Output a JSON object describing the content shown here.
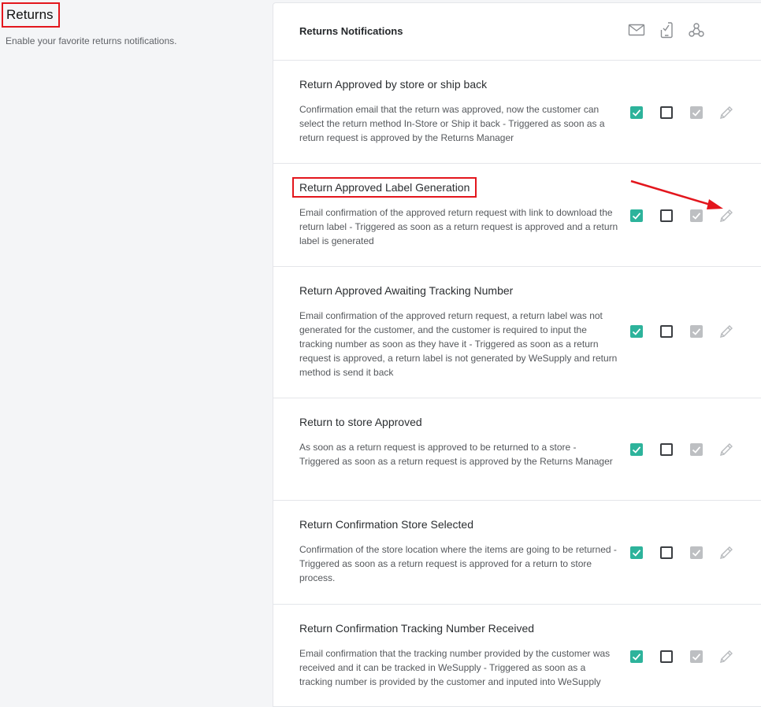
{
  "section": {
    "title": "Returns",
    "description": "Enable your favorite returns notifications."
  },
  "card": {
    "title": "Returns Notifications",
    "channel_icons": [
      "email-icon",
      "sms-icon",
      "webhook-icon"
    ]
  },
  "colors": {
    "accent_checked": "#2db39b",
    "disabled_checked": "#bdbfc2",
    "annotation_red": "#e3161d"
  },
  "notifications": [
    {
      "title": "Return Approved by store or ship back",
      "description": "Confirmation email that the return was approved, now the customer can select the return method In-Store or Ship it back - Triggered as soon as a return request is approved by the Returns Manager",
      "email": true,
      "sms": false,
      "webhook": true
    },
    {
      "title": "Return Approved Label Generation",
      "description": "Email confirmation of the approved return request with link to download the return label - Triggered as soon as a return request is approved and a return label is generated",
      "email": true,
      "sms": false,
      "webhook": true
    },
    {
      "title": "Return Approved Awaiting Tracking Number",
      "description": "Email confirmation of the approved return request, a return label was not generated for the customer, and the customer is required to input the tracking number as soon as they have it - Triggered as soon as a return request is approved, a return label is not generated by WeSupply and return method is send it back",
      "email": true,
      "sms": false,
      "webhook": true
    },
    {
      "title": "Return to store Approved",
      "description": "As soon as a return request is approved to be returned to a store - Triggered as soon as a return request is approved by the Returns Manager",
      "email": true,
      "sms": false,
      "webhook": true
    },
    {
      "title": "Return Confirmation Store Selected",
      "description": "Confirmation of the store location where the items are going to be returned - Triggered as soon as a return request is approved for a return to store process.",
      "email": true,
      "sms": false,
      "webhook": true
    },
    {
      "title": "Return Confirmation Tracking Number Received",
      "description": "Email confirmation that the tracking number provided by the customer was received and it can be tracked in WeSupply - Triggered as soon as a tracking number is provided by the customer and inputed into WeSupply",
      "email": true,
      "sms": false,
      "webhook": true
    }
  ]
}
